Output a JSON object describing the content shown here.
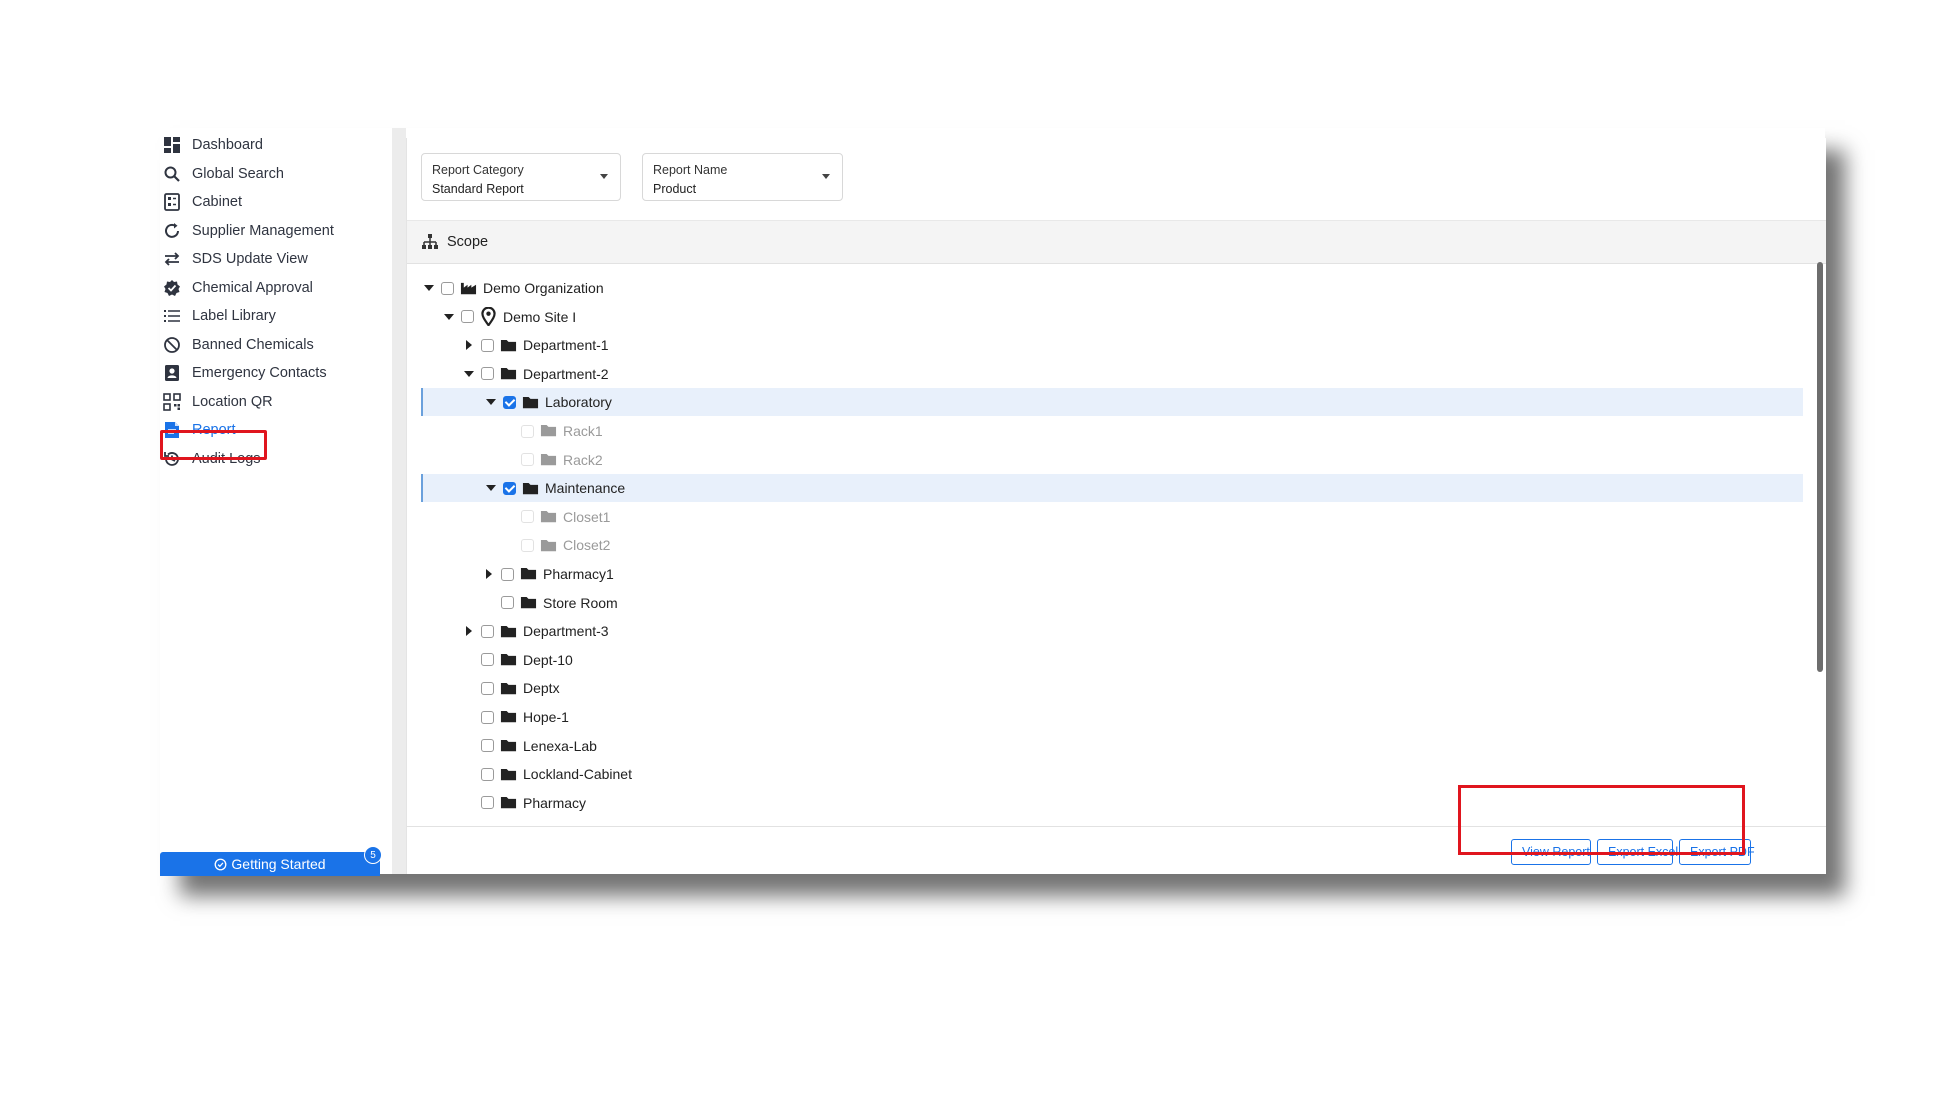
{
  "sidebar": {
    "items": [
      {
        "label": "Dashboard",
        "icon": "dashboard-icon"
      },
      {
        "label": "Global Search",
        "icon": "search-icon"
      },
      {
        "label": "Cabinet",
        "icon": "cabinet-icon"
      },
      {
        "label": "Supplier Management",
        "icon": "refresh-icon"
      },
      {
        "label": "SDS Update View",
        "icon": "swap-arrows-icon"
      },
      {
        "label": "Chemical Approval",
        "icon": "badge-check-icon"
      },
      {
        "label": "Label Library",
        "icon": "list-icon"
      },
      {
        "label": "Banned Chemicals",
        "icon": "banned-icon"
      },
      {
        "label": "Emergency Contacts",
        "icon": "contact-card-icon"
      },
      {
        "label": "Location QR",
        "icon": "qr-code-icon"
      },
      {
        "label": "Report",
        "icon": "report-icon",
        "active": true
      },
      {
        "label": "Audit Logs",
        "icon": "history-icon"
      }
    ],
    "getting_started": {
      "label": "Getting Started",
      "badge": "5"
    }
  },
  "filters": {
    "category": {
      "label": "Report Category",
      "value": "Standard Report"
    },
    "name": {
      "label": "Report Name",
      "value": "Product"
    }
  },
  "scope": {
    "title": "Scope"
  },
  "tree": [
    {
      "label": "Demo Organization",
      "icon": "factory-icon",
      "caret": "down",
      "checked": false
    },
    {
      "label": "Demo Site I",
      "icon": "location-pin-icon",
      "caret": "down",
      "checked": false
    },
    {
      "label": "Department-1",
      "icon": "folder-icon",
      "caret": "right",
      "checked": false
    },
    {
      "label": "Department-2",
      "icon": "folder-icon",
      "caret": "down",
      "checked": false
    },
    {
      "label": "Laboratory",
      "icon": "folder-icon",
      "caret": "down",
      "checked": true,
      "selected": true
    },
    {
      "label": "Rack1",
      "icon": "folder-icon",
      "caret": "none",
      "checked": false,
      "disabled": true
    },
    {
      "label": "Rack2",
      "icon": "folder-icon",
      "caret": "none",
      "checked": false,
      "disabled": true
    },
    {
      "label": "Maintenance",
      "icon": "folder-icon",
      "caret": "down",
      "checked": true,
      "selected": true
    },
    {
      "label": "Closet1",
      "icon": "folder-icon",
      "caret": "none",
      "checked": false,
      "disabled": true
    },
    {
      "label": "Closet2",
      "icon": "folder-icon",
      "caret": "none",
      "checked": false,
      "disabled": true
    },
    {
      "label": "Pharmacy1",
      "icon": "folder-icon",
      "caret": "right",
      "checked": false
    },
    {
      "label": "Store Room",
      "icon": "folder-icon",
      "caret": "none",
      "checked": false
    },
    {
      "label": "Department-3",
      "icon": "folder-icon",
      "caret": "right",
      "checked": false
    },
    {
      "label": "Dept-10",
      "icon": "folder-icon",
      "caret": "none",
      "checked": false
    },
    {
      "label": "Deptx",
      "icon": "folder-icon",
      "caret": "none",
      "checked": false
    },
    {
      "label": "Hope-1",
      "icon": "folder-icon",
      "caret": "none",
      "checked": false
    },
    {
      "label": "Lenexa-Lab",
      "icon": "folder-icon",
      "caret": "none",
      "checked": false
    },
    {
      "label": "Lockland-Cabinet",
      "icon": "folder-icon",
      "caret": "none",
      "checked": false
    },
    {
      "label": "Pharmacy",
      "icon": "folder-icon",
      "caret": "none",
      "checked": false
    }
  ],
  "actions": {
    "view_report": "View Report",
    "export_excel": "Export Excel",
    "export_pdf": "Export PDF"
  },
  "colors": {
    "accent": "#1a73e8",
    "highlight": "#e0151e",
    "selected_row": "#e8f0fb"
  }
}
